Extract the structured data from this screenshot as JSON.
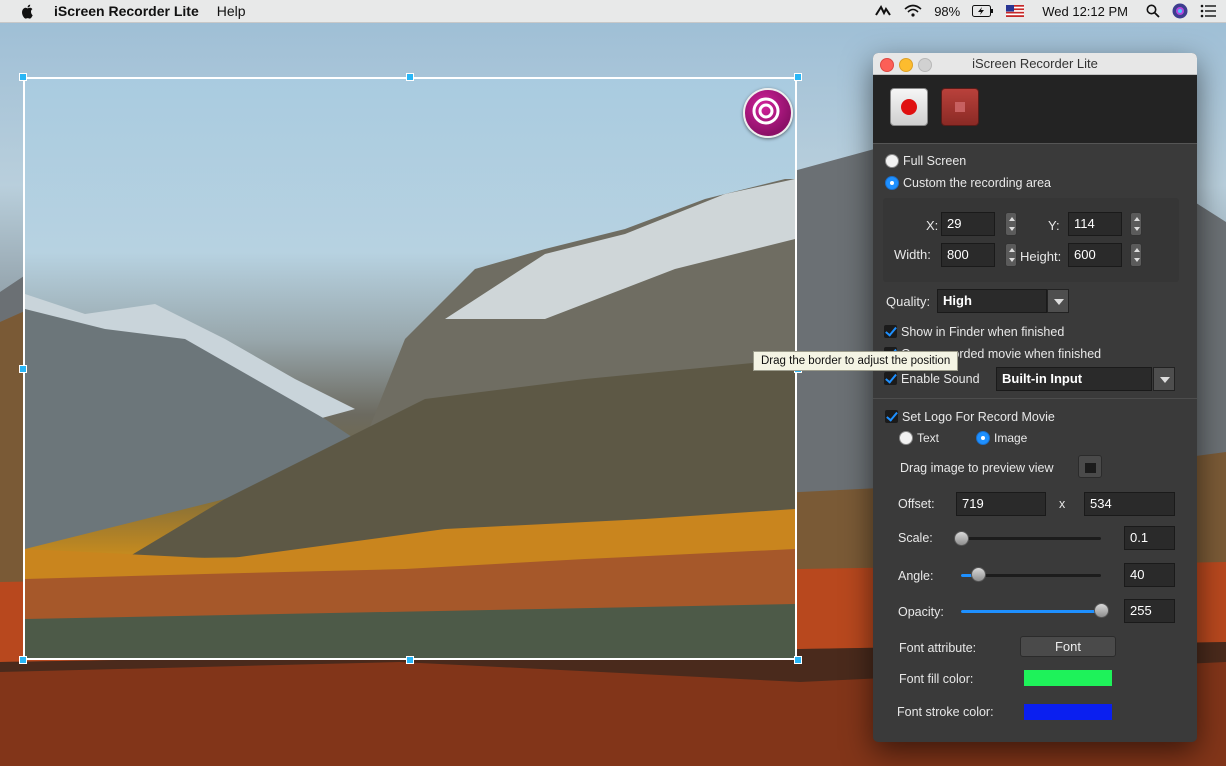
{
  "menubar": {
    "app_name": "iScreen Recorder Lite",
    "menus": [
      "Help"
    ],
    "battery": "98%",
    "clock": "Wed 12:12 PM"
  },
  "tooltip": "Drag the border to adjust the position",
  "window": {
    "title": "iScreen Recorder Lite",
    "mode": {
      "full_screen": "Full Screen",
      "custom_area": "Custom the recording area",
      "selected": "custom_area"
    },
    "area": {
      "x_label": "X:",
      "x": "29",
      "y_label": "Y:",
      "y": "114",
      "width_label": "Width:",
      "width": "800",
      "height_label": "Height:",
      "height": "600"
    },
    "quality": {
      "label": "Quality:",
      "value": "High"
    },
    "options": {
      "show_finder": "Show in Finder when finished",
      "open_movie": "Open recorded movie when finished",
      "enable_sound": "Enable Sound",
      "sound_input": "Built-in Input"
    },
    "logo": {
      "set_logo": "Set Logo For Record Movie",
      "text_option": "Text",
      "image_option": "Image",
      "selected": "image",
      "drag_hint": "Drag image to preview view",
      "offset_label": "Offset:",
      "offset_x": "719",
      "offset_sep": "x",
      "offset_y": "534",
      "scale_label": "Scale:",
      "scale": "0.1",
      "scale_fraction": 0.0,
      "angle_label": "Angle:",
      "angle": "40",
      "angle_fraction": 0.12,
      "opacity_label": "Opacity:",
      "opacity": "255",
      "opacity_fraction": 1.0,
      "font_attr_label": "Font attribute:",
      "font_button": "Font",
      "fill_color_label": "Font fill color:",
      "fill_color": "#1ef25a",
      "stroke_color_label": "Font stroke color:",
      "stroke_color": "#0a1ff0"
    }
  }
}
